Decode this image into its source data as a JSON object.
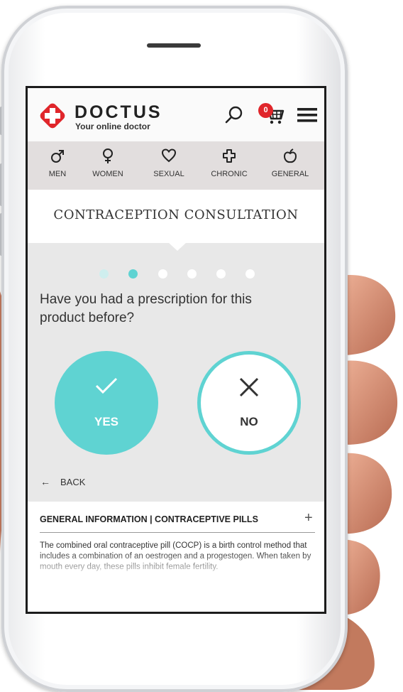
{
  "brand": {
    "name": "DOCTUS",
    "tagline": "Your online doctor"
  },
  "header": {
    "cart_count": "0",
    "icons": [
      "search-icon",
      "cart-icon",
      "menu-icon"
    ]
  },
  "categories": [
    {
      "label": "MEN",
      "icon": "male-icon"
    },
    {
      "label": "WOMEN",
      "icon": "female-icon"
    },
    {
      "label": "SEXUAL",
      "icon": "heart-icon"
    },
    {
      "label": "CHRONIC",
      "icon": "cross-icon"
    },
    {
      "label": "GENERAL",
      "icon": "apple-icon"
    }
  ],
  "page": {
    "title": "CONTRACEPTION CONSULTATION"
  },
  "progress": {
    "total_steps": 6,
    "current_step": 2
  },
  "question": {
    "text": "Have you had a prescription for this product before?"
  },
  "answers": {
    "yes_label": "YES",
    "no_label": "NO"
  },
  "navigation": {
    "back_label": "BACK"
  },
  "info": {
    "title": "GENERAL INFORMATION | CONTRACEPTIVE PILLS",
    "body": "The combined oral contraceptive pill (COCP) is a birth control method that includes a combination of an oestrogen and a progestogen. When taken by mouth every day, these pills inhibit female fertility."
  },
  "colors": {
    "accent": "#5fd3d2",
    "brand_red": "#e0262b",
    "dot_inactive": "#ffffff",
    "dot_done": "#cfeeee"
  }
}
